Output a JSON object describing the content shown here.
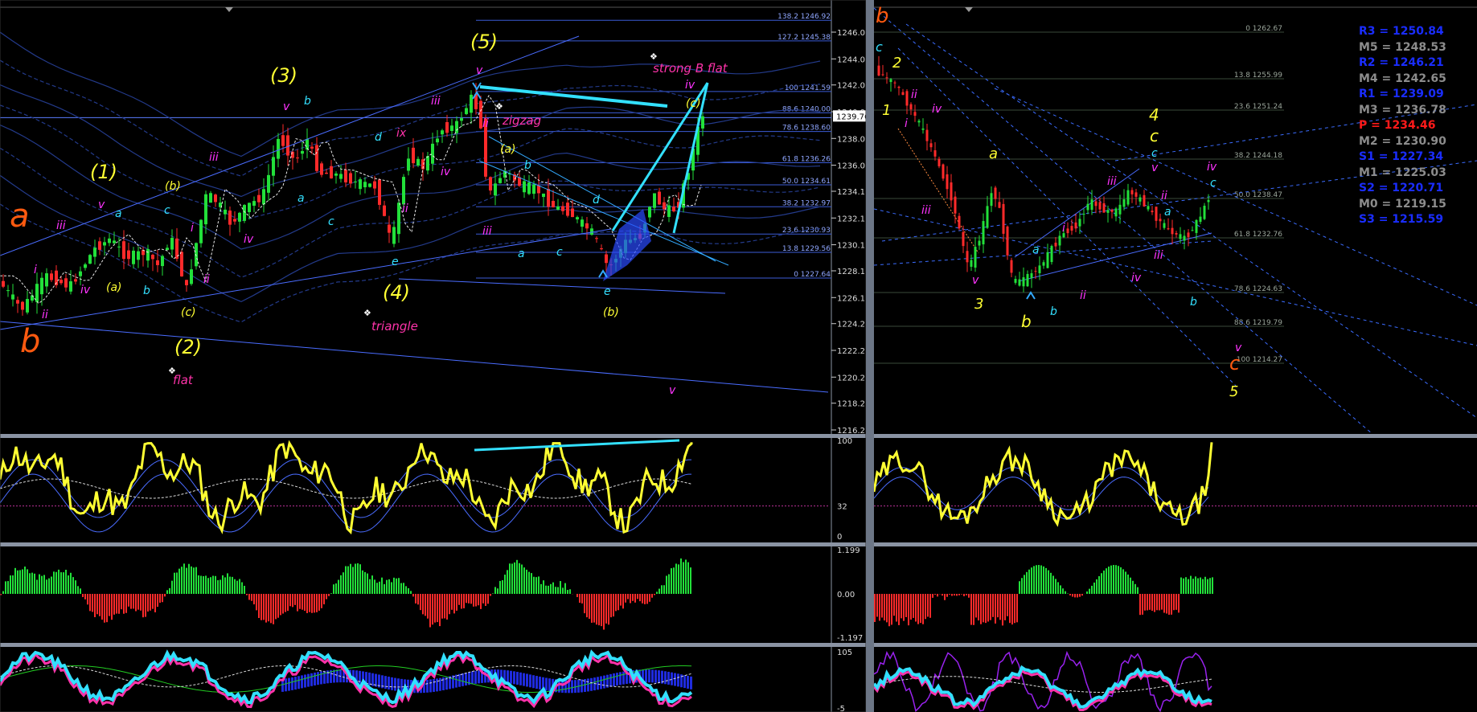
{
  "colors": {
    "background": "#000000",
    "grid": "#1a2a66",
    "fib_line": "#3b5bd6",
    "candle_up": "#22e03a",
    "candle_down": "#ff2a2a",
    "yellow": "#ffff33",
    "magenta": "#ff33ff",
    "cyan": "#33e0ff",
    "orange": "#ff5a10",
    "pink": "#ff33aa",
    "divider": "#6c7686"
  },
  "left_price_axis": [
    "1246.03",
    "1244.03",
    "1242.08",
    "1240.08",
    "1238.08",
    "1236.08",
    "1234.13",
    "1232.13",
    "1230.13",
    "1228.18",
    "1226.18",
    "1224.23",
    "1222.23",
    "1220.23",
    "1218.28",
    "1216.28"
  ],
  "current_price": "1239.76",
  "left_fib_levels": [
    "138.2 1246.92",
    "127.2 1245.38",
    "100 1241.59",
    "88.6 1240.00",
    "78.6 1238.60",
    "61.8 1236.26",
    "50.0 1234.61",
    "38.2 1232.97",
    "23.6 1230.93",
    "13.8 1229.56",
    "0 1227.64"
  ],
  "right_fib_levels": [
    "0 1262.67",
    "13.8 1255.99",
    "23.6 1251.24",
    "38.2 1244.18",
    "50.0 1238.47",
    "61.8 1232.76",
    "78.6 1224.63",
    "88.6 1219.79",
    "100 1214.27"
  ],
  "pivots": [
    {
      "label": "R3 = 1250.84",
      "color": "#1a2dff"
    },
    {
      "label": "M5 = 1248.53",
      "color": "#8c8c8c"
    },
    {
      "label": "R2 = 1246.21",
      "color": "#1a2dff"
    },
    {
      "label": "M4 = 1242.65",
      "color": "#8c8c8c"
    },
    {
      "label": "R1 = 1239.09",
      "color": "#1a2dff"
    },
    {
      "label": "M3 = 1236.78",
      "color": "#8c8c8c"
    },
    {
      "label": "P  = 1234.46",
      "color": "#ff1a1a"
    },
    {
      "label": "M2 = 1230.90",
      "color": "#8c8c8c"
    },
    {
      "label": "S1 = 1227.34",
      "color": "#1a2dff"
    },
    {
      "label": "M1 = 1225.03",
      "color": "#8c8c8c"
    },
    {
      "label": "S2 = 1220.71",
      "color": "#1a2dff"
    },
    {
      "label": "M0 = 1219.15",
      "color": "#8c8c8c"
    },
    {
      "label": "S3 = 1215.59",
      "color": "#1a2dff"
    }
  ],
  "rsi_axis": [
    "100",
    "32",
    "0"
  ],
  "macd_axis": [
    "1.199",
    "0.00",
    "-1.197"
  ],
  "stoch_axis": [
    "105",
    "-5"
  ],
  "left_labels": {
    "a_big": "a",
    "b_big": "b",
    "w1": "(1)",
    "w2": "(2)",
    "w3": "(3)",
    "w4": "(4)",
    "w5": "(5)",
    "flat": "flat",
    "triangle": "triangle",
    "zigzag": "zigzag",
    "strong_b_flat": "strong B flat"
  },
  "right_labels": {
    "b_top": "b",
    "c_top": "c",
    "one": "1",
    "two": "2",
    "three": "3",
    "four": "4",
    "five": "5",
    "a1": "a",
    "b1": "b",
    "c1": "c",
    "c_orange": "c"
  },
  "chart_data": {
    "type": "candlestick",
    "panels": [
      {
        "name": "left-price",
        "y_axis": [
          1216.28,
          1246.92
        ],
        "fib_retracement": {
          "levels_pct": [
            138.2,
            127.2,
            100,
            88.6,
            78.6,
            61.8,
            50.0,
            38.2,
            23.6,
            13.8,
            0
          ],
          "prices": [
            1246.92,
            1245.38,
            1241.59,
            1240.0,
            1238.6,
            1236.26,
            1234.61,
            1232.97,
            1230.93,
            1229.56,
            1227.64
          ]
        },
        "last_price": 1239.76
      },
      {
        "name": "right-price",
        "fib_retracement": {
          "levels_pct": [
            0,
            13.8,
            23.6,
            38.2,
            50.0,
            61.8,
            78.6,
            88.6,
            100
          ],
          "prices": [
            1262.67,
            1255.99,
            1251.24,
            1244.18,
            1238.47,
            1232.76,
            1224.63,
            1219.79,
            1214.27
          ]
        },
        "pivot_points": {
          "R3": 1250.84,
          "M5": 1248.53,
          "R2": 1246.21,
          "M4": 1242.65,
          "R1": 1239.09,
          "M3": 1236.78,
          "P": 1234.46,
          "M2": 1230.9,
          "S1": 1227.34,
          "M1": 1225.03,
          "S2": 1220.71,
          "M0": 1219.15,
          "S3": 1215.59
        }
      },
      {
        "name": "rsi",
        "y_axis": [
          0,
          100
        ],
        "levels": [
          32
        ]
      },
      {
        "name": "macd-histogram",
        "y_axis": [
          -1.197,
          1.199
        ]
      },
      {
        "name": "stochastic",
        "y_axis": [
          -5,
          105
        ]
      }
    ]
  }
}
